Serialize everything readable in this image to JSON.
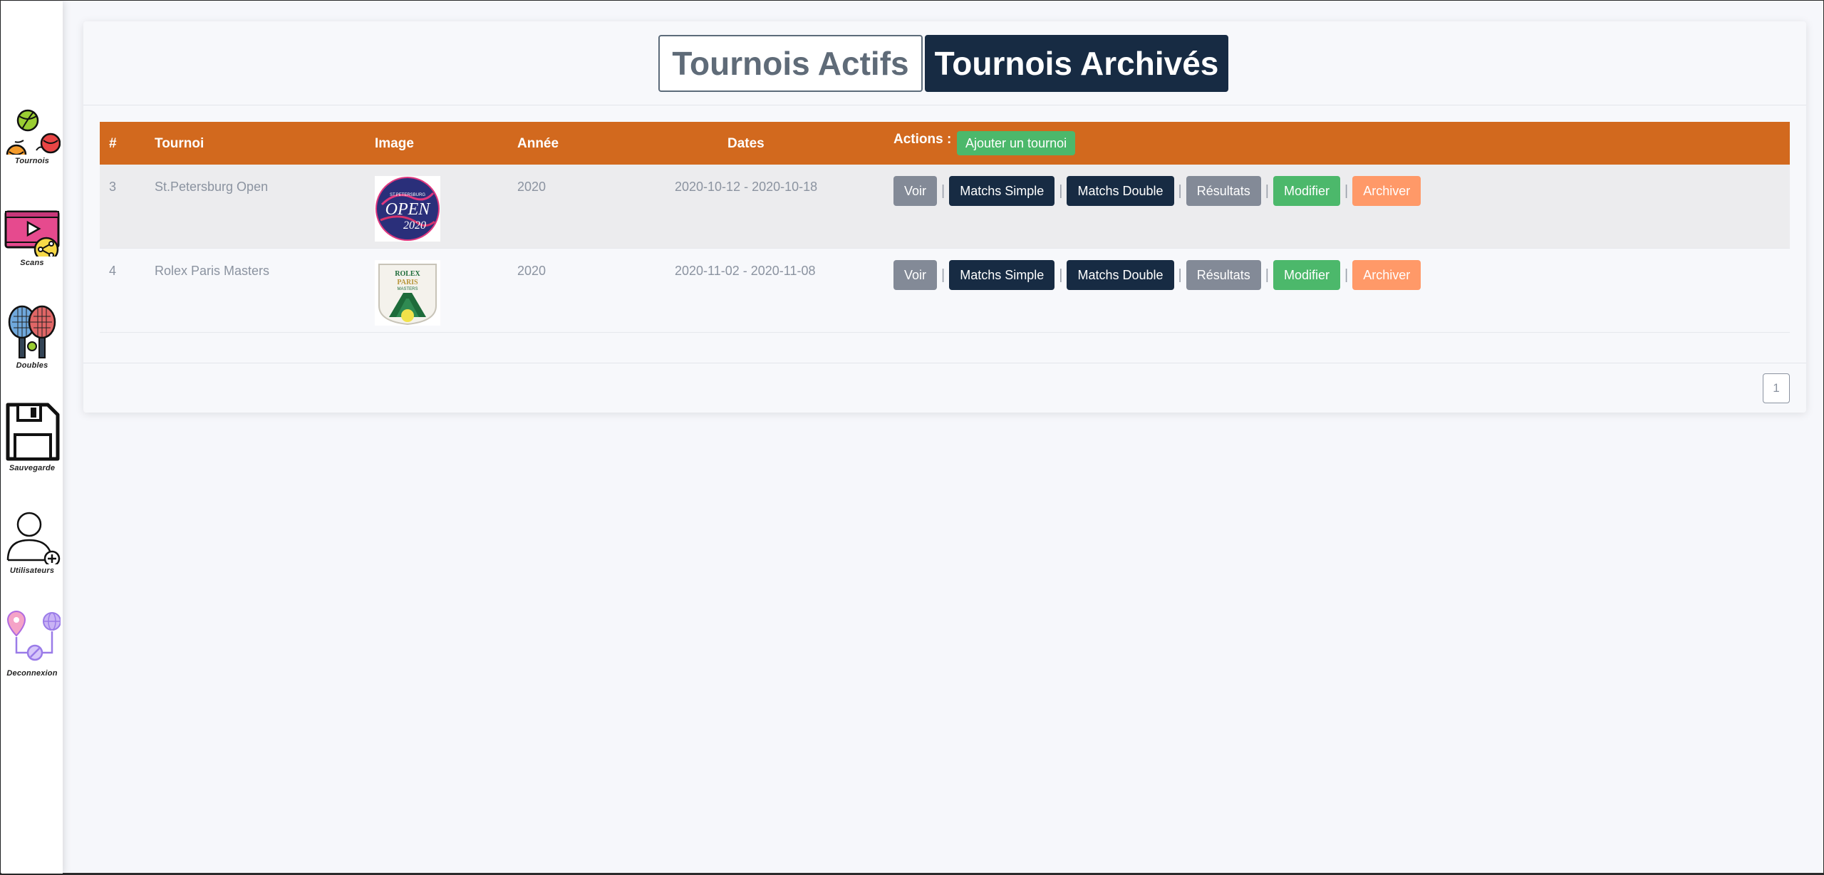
{
  "sidebar": {
    "items": [
      {
        "label": "Tournois",
        "icon": "tennis-balls-icon"
      },
      {
        "label": "Scans",
        "icon": "video-share-icon"
      },
      {
        "label": "Doubles",
        "icon": "rackets-icon"
      },
      {
        "label": "Sauvegarde",
        "icon": "floppy-disk-icon"
      },
      {
        "label": "Utilisateurs",
        "icon": "add-user-icon"
      },
      {
        "label": "Deconnexion",
        "icon": "location-network-icon"
      }
    ]
  },
  "tabs": {
    "active_label": "Tournois Actifs",
    "archived_label": "Tournois Archivés"
  },
  "table": {
    "headers": {
      "num": "#",
      "tournament": "Tournoi",
      "image": "Image",
      "year": "Année",
      "dates": "Dates",
      "actions": "Actions :"
    },
    "add_button": "Ajouter un tournoi",
    "rows": [
      {
        "num": "3",
        "name": "St.Petersburg Open",
        "year": "2020",
        "dates": "2020-10-12 - 2020-10-18",
        "logo": "st-petersburg-open-logo"
      },
      {
        "num": "4",
        "name": "Rolex Paris Masters",
        "year": "2020",
        "dates": "2020-11-02 - 2020-11-08",
        "logo": "rolex-paris-masters-logo"
      }
    ],
    "row_actions": {
      "view": "Voir",
      "singles": "Matchs Simple",
      "doubles": "Matchs Double",
      "results": "Résultats",
      "edit": "Modifier",
      "archive": "Archiver"
    },
    "separator": "|"
  },
  "pagination": {
    "current": "1"
  },
  "colors": {
    "header_orange": "#d2691e",
    "navy": "#172b43",
    "green": "#4cb86b",
    "grey": "#838a97",
    "salmon": "#ff9968"
  }
}
